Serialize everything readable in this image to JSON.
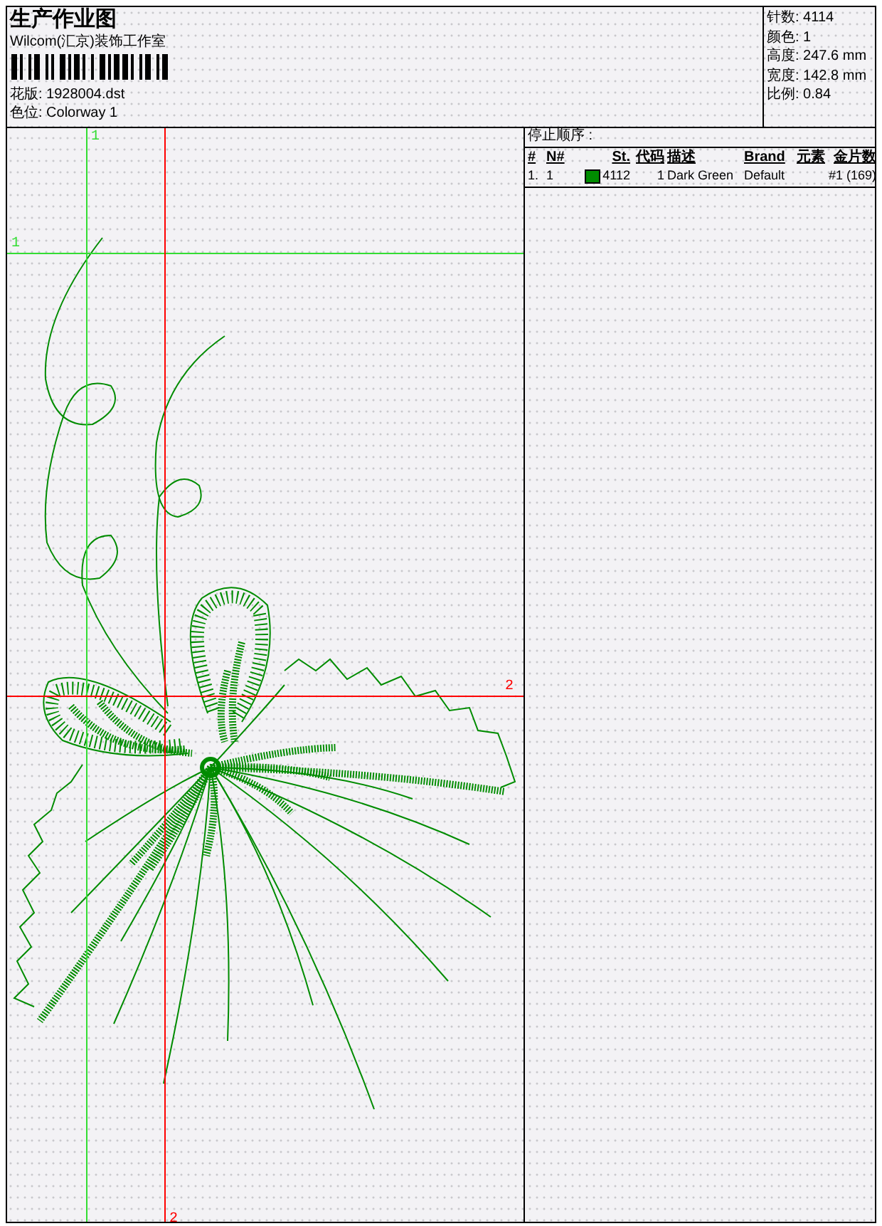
{
  "header": {
    "title": "生产作业图",
    "company": "Wilcom(汇京)装饰工作室",
    "design_file": {
      "label": "花版:",
      "value": "1928004.dst"
    },
    "colorway": {
      "label": "色位:",
      "value": "Colorway 1"
    }
  },
  "stats": [
    {
      "label": "针数:",
      "value": "4114"
    },
    {
      "label": "颜色:",
      "value": "1"
    },
    {
      "label": "高度:",
      "value": "247.6 mm"
    },
    {
      "label": "宽度:",
      "value": "142.8 mm"
    },
    {
      "label": "比例:",
      "value": "0.84"
    }
  ],
  "guides": [
    {
      "kind": "vertical",
      "label": "1",
      "color": "#33dd33"
    },
    {
      "kind": "horizontal",
      "label": "1",
      "color": "#33dd33"
    },
    {
      "kind": "vertical",
      "label": "2",
      "color": "#ff0000"
    },
    {
      "kind": "horizontal",
      "label": "2",
      "color": "#ff0000"
    }
  ],
  "stop_sequence": {
    "title": "停止顺序 :",
    "columns": [
      "#",
      "N#",
      "St.",
      "代码",
      "描述",
      "Brand",
      "元素",
      "金片数"
    ],
    "rows": [
      {
        "index": "1.",
        "needle": "1",
        "color": "#008c00",
        "stitches": "4112",
        "code": "1",
        "description": "Dark Green",
        "brand": "Default",
        "elements": "#1 (169)"
      }
    ]
  }
}
